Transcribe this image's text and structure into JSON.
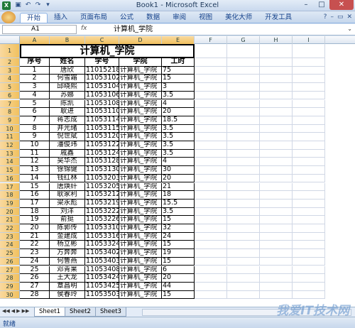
{
  "window": {
    "title": "Book1 - Microsoft Excel"
  },
  "ribbon": {
    "tabs": [
      "开始",
      "插入",
      "页面布局",
      "公式",
      "数据",
      "审阅",
      "视图",
      "美化大师",
      "开发工具"
    ]
  },
  "formula_bar": {
    "name_box": "A1",
    "fx": "fx",
    "content": "计算机_学院"
  },
  "columns": [
    "A",
    "B",
    "C",
    "D",
    "E",
    "F",
    "G",
    "H",
    "I"
  ],
  "sheet": {
    "title": "计算机_学院",
    "headers": [
      "序号",
      "姓名",
      "学号",
      "学院",
      "工时"
    ],
    "rows": [
      [
        "1",
        "唐欣",
        "11015218",
        "计算机_学院",
        "75"
      ],
      [
        "2",
        "何雪霜",
        "11053102",
        "计算机_学院",
        "15"
      ],
      [
        "3",
        "邱晓熙",
        "11053104",
        "计算机_学院",
        "3"
      ],
      [
        "4",
        "苏娜",
        "11053106",
        "计算机_学院",
        "3.5"
      ],
      [
        "5",
        "陈凯",
        "11053108",
        "计算机_学院",
        "4"
      ],
      [
        "6",
        "耿进",
        "11053110",
        "计算机_学院",
        "20"
      ],
      [
        "7",
        "蒋志成",
        "11053114",
        "计算机_学院",
        "18.5"
      ],
      [
        "8",
        "井光绪",
        "11053115",
        "计算机_学院",
        "3.5"
      ],
      [
        "9",
        "倪世斌",
        "11053120",
        "计算机_学院",
        "3.5"
      ],
      [
        "10",
        "潘俊玮",
        "11053122",
        "计算机_学院",
        "3.5"
      ],
      [
        "11",
        "戚鑫",
        "11053124",
        "计算机_学院",
        "3.5"
      ],
      [
        "12",
        "吴华杰",
        "11053128",
        "计算机_学院",
        "4"
      ],
      [
        "13",
        "徐锦健",
        "11053130",
        "计算机_学院",
        "30"
      ],
      [
        "14",
        "钱红林",
        "11053203",
        "计算机_学院",
        "20"
      ],
      [
        "15",
        "唐焕纤",
        "11053205",
        "计算机_学院",
        "21"
      ],
      [
        "16",
        "耿家利",
        "11053212",
        "计算机_学院",
        "18"
      ],
      [
        "17",
        "梁永彪",
        "11053219",
        "计算机_学院",
        "15.5"
      ],
      [
        "18",
        "刘洋",
        "11053222",
        "计算机_学院",
        "3.5"
      ],
      [
        "19",
        "俞挺",
        "11053226",
        "计算机_学院",
        "15"
      ],
      [
        "20",
        "陈郭传",
        "11053310",
        "计算机_学院",
        "32"
      ],
      [
        "21",
        "金建成",
        "11053316",
        "计算机_学院",
        "24"
      ],
      [
        "22",
        "杨立彬",
        "11053324",
        "计算机_学院",
        "15"
      ],
      [
        "23",
        "方奔奔",
        "11053402",
        "计算机_学院",
        "19"
      ],
      [
        "24",
        "何鲁燕",
        "11053403",
        "计算机_学院",
        "15"
      ],
      [
        "25",
        "邓青果",
        "11053408",
        "计算机_学院",
        "6"
      ],
      [
        "26",
        "王大龙",
        "11053424",
        "计算机_学院",
        "20"
      ],
      [
        "27",
        "覃昌明",
        "11053425",
        "计算机_学院",
        "44"
      ],
      [
        "28",
        "侯春玲",
        "11053503",
        "计算机_学院",
        "15"
      ]
    ]
  },
  "sheet_tabs": [
    "Sheet1",
    "Sheet2",
    "Sheet3"
  ],
  "status": {
    "ready": "就绪"
  },
  "watermark": "我爱IT技术网"
}
